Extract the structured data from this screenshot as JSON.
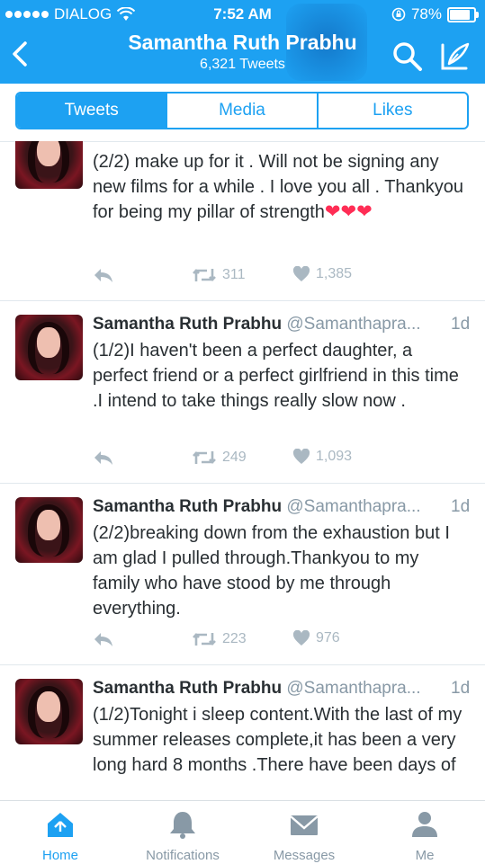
{
  "status_bar": {
    "carrier": "DIALOG",
    "time": "7:52 AM",
    "battery": "78%"
  },
  "header": {
    "title": "Samantha Ruth Prabhu",
    "subtitle": "6,321 Tweets"
  },
  "tabs": [
    "Tweets",
    "Media",
    "Likes"
  ],
  "tweets": [
    {
      "name": "",
      "handle": "",
      "age": "",
      "text": "(2/2) make up for it . Will not be signing any new films for a while . I love you all . Thankyou for being my pillar of strength",
      "emoji": "❤❤❤",
      "retweets": "311",
      "likes": "1,385"
    },
    {
      "name": "Samantha Ruth Prabhu",
      "handle": "@Samanthapra...",
      "age": "1d",
      "text": "(1/2)I haven't been a perfect daughter, a perfect friend or a perfect girlfriend in this time .I intend to take things really slow now .",
      "emoji": "",
      "retweets": "249",
      "likes": "1,093"
    },
    {
      "name": "Samantha Ruth Prabhu",
      "handle": "@Samanthapra...",
      "age": "1d",
      "text": "(2/2)breaking down from the exhaustion but I am glad I pulled through.Thankyou to my family  who have stood by me through everything.",
      "emoji": "",
      "retweets": "223",
      "likes": "976"
    },
    {
      "name": "Samantha Ruth Prabhu",
      "handle": "@Samanthapra...",
      "age": "1d",
      "text": "(1/2)Tonight i sleep content.With the last of my summer releases complete,it has been a very long hard 8 months .There have been days of",
      "emoji": "",
      "retweets": "",
      "likes": ""
    }
  ],
  "bottom_tabs": [
    "Home",
    "Notifications",
    "Messages",
    "Me"
  ],
  "colors": {
    "brand": "#1da1f2",
    "muted": "#aab8c2",
    "heart": "#ff2d55"
  }
}
